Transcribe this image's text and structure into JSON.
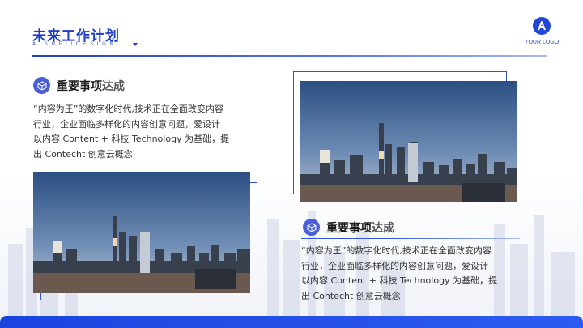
{
  "header": {
    "title": "未来工作计划",
    "subtitle": "AISHEJIDESIGN"
  },
  "logo": {
    "text": "YOUR LOGO"
  },
  "items": [
    {
      "title_main": "重要事项",
      "title_accent": "达成",
      "lines": [
        "“内容为王”的数字化时代,技术正在全面改变内容",
        "行业，企业面临多样化的内容创意问题，爱设计",
        "以内容 Content + 科技 Technology 为基础，提",
        "出 Contecht 创意云概念"
      ]
    },
    {
      "title_main": "重要事项",
      "title_accent": "达成",
      "lines": [
        "“内容为王”的数字化时代,技术正在全面改变内容",
        "行业，企业面临多样化的内容创意问题，爱设计",
        "以内容 Content + 科技 Technology 为基础，提",
        "出 Contecht 创意云概念"
      ]
    }
  ],
  "colors": {
    "brand": "#1e3fc8",
    "accent": "#2d51d8"
  }
}
